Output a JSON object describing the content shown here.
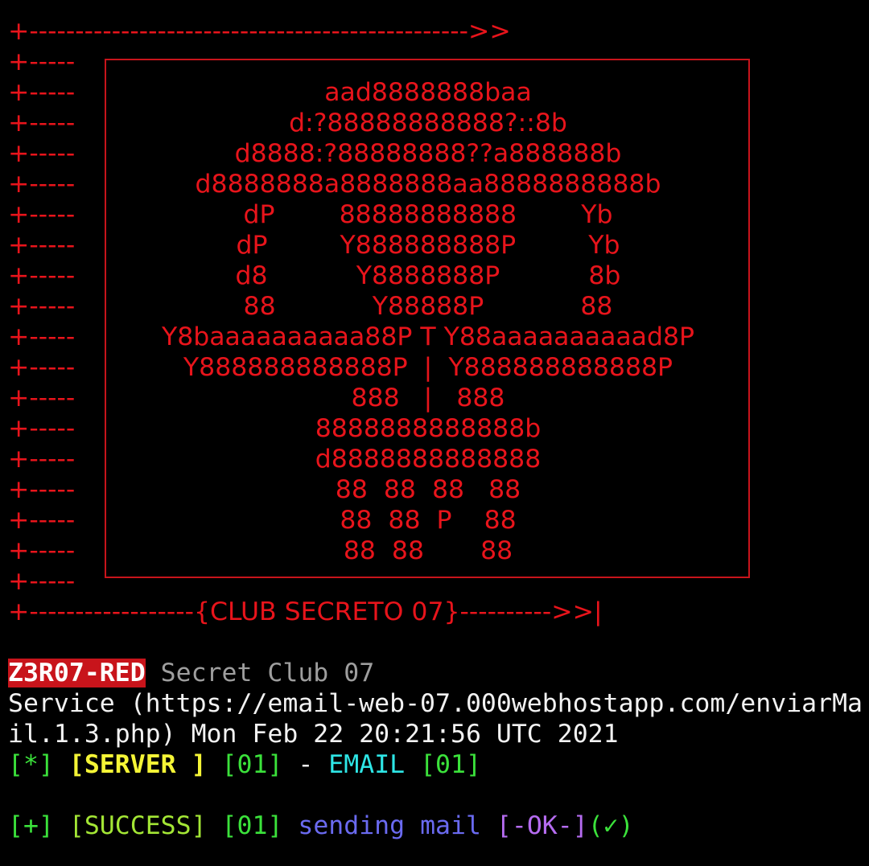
{
  "banner": {
    "top_arrow": "+------------------------------------------------>>",
    "prefix": "+-----",
    "art_lines": [
      "",
      "aad8888888baa",
      "d:?88888888888?::8b",
      "d8888:?88888888??a888888b",
      "d8888888a8888888aa8888888888b",
      "dP        88888888888        Yb",
      "dP         Y888888888P         Yb",
      "d8           Y8888888P           8b",
      "88            Y88888P            88",
      "Y8baaaaaaaaaa88P T Y88aaaaaaaaaad8P",
      "Y888888888888P  |  Y888888888888P",
      "888   |   888",
      "8888888888888b",
      "d8888888888888",
      "88  88  88   88",
      "88  88  P    88",
      "88  88       88",
      ""
    ],
    "bottom_line": "+------------------{CLUB SECRETO 07}---------->>|"
  },
  "header": {
    "badge": "Z3R07-RED",
    "title": " Secret Club 07"
  },
  "log": {
    "service_line_1": "Service (https://email-web-07.000webhostapp.com/enviarMa",
    "service_line_2": "il.1.3.php) Mon Feb 22 20:21:56 UTC 2021",
    "server_line": {
      "star": "[*]",
      "server": "[SERVER ]",
      "count1": "[01]",
      "dash": " - ",
      "email": "EMAIL",
      "count2": "[01]"
    },
    "success_line": {
      "plus": "[+]",
      "success": "[SUCCESS]",
      "count": "[01]",
      "sending": "sending mail",
      "ok": "[-OK-]",
      "check": "(✓)"
    }
  },
  "colors": {
    "background": "#000000",
    "banner_red": "#e8141b",
    "badge_bg": "#c8141b"
  }
}
